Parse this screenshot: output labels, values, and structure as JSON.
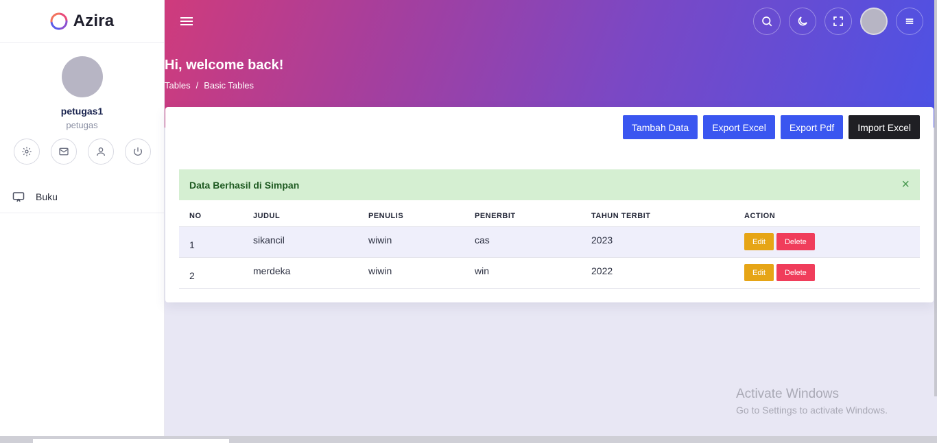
{
  "brand": {
    "name": "Azira"
  },
  "profile": {
    "name": "petugas1",
    "role": "petugas"
  },
  "sidebar": {
    "items": [
      {
        "label": "Buku",
        "icon": "monitor-icon"
      }
    ]
  },
  "header": {
    "welcome": "Hi, welcome back!",
    "breadcrumb": [
      "Tables",
      "/",
      "Basic Tables"
    ]
  },
  "toolbar": {
    "tambah_label": "Tambah Data",
    "export_excel_label": "Export Excel",
    "export_pdf_label": "Export Pdf",
    "import_excel_label": "Import Excel"
  },
  "alert": {
    "message": "Data Berhasil di Simpan",
    "close": "×"
  },
  "table": {
    "headers": [
      "NO",
      "JUDUL",
      "PENULIS",
      "PENERBIT",
      "TAHUN TERBIT",
      "ACTION"
    ],
    "rows": [
      {
        "no": "1",
        "judul": "sikancil",
        "penulis": "wiwin",
        "penerbit": "cas",
        "tahun": "2023",
        "edit": "Edit",
        "delete": "Delete"
      },
      {
        "no": "2",
        "judul": "merdeka",
        "penulis": "wiwin",
        "penerbit": "win",
        "tahun": "2022",
        "edit": "Edit",
        "delete": "Delete"
      }
    ]
  },
  "watermark": {
    "title": "Activate Windows",
    "subtitle": "Go to Settings to activate Windows."
  },
  "colors": {
    "primary": "#3a56f0",
    "dark": "#1f1f24",
    "edit": "#e6a516",
    "delete": "#f03d5b",
    "alert_bg": "#d5efd2"
  }
}
